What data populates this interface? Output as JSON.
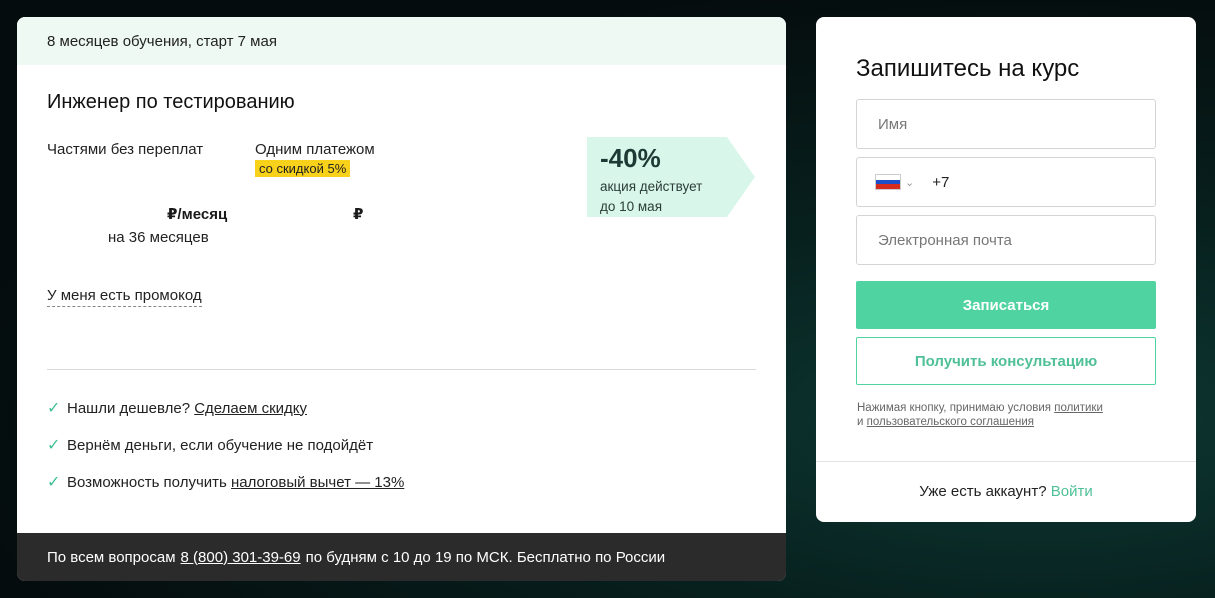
{
  "course": {
    "duration_start": "8 месяцев обучения, старт 7 мая",
    "title": "Инженер по тестированию",
    "pay_installment_label": "Частями без переплат",
    "pay_single_label": "Одним платежом",
    "single_discount_chip": "со скидкой 5%",
    "installment_price": "₽/месяц",
    "installment_term": "на 36 месяцев",
    "single_price": "₽",
    "promo_link": "У меня есть промокод"
  },
  "sale": {
    "percent": "-40%",
    "line1": "акция действует",
    "line2": "до 10 мая",
    "color": "#d9f6ea"
  },
  "benefits": [
    {
      "icon": "check-icon",
      "text": "Нашли дешевле?",
      "link": "Сделаем скидку"
    },
    {
      "icon": "check-icon",
      "text": "Вернём деньги, если обучение не подойдёт",
      "link": ""
    },
    {
      "icon": "check-icon",
      "text": "Возможность получить",
      "link": "налоговый вычет — 13%"
    }
  ],
  "footer": {
    "prefix": "По всем вопросам",
    "phone": "8 (800) 301-39-69",
    "suffix": "по будням с 10 до 19 по МСК. Бесплатно по России"
  },
  "form": {
    "title": "Запишитесь на курс",
    "name_placeholder": "Имя",
    "phone_prefix": "+7",
    "country_flag": "russia-flag-icon",
    "email_placeholder": "Электронная почта",
    "submit_label": "Записаться",
    "consult_label": "Получить консультацию",
    "legal_text": "Нажимая кнопку, принимаю условия",
    "legal_link1": "политики",
    "legal_and": "и",
    "legal_link2": "пользовательского соглашения",
    "login_prompt": "Уже есть аккаунт?",
    "login_link": "Войти",
    "accent_color": "#4fd3a0"
  }
}
